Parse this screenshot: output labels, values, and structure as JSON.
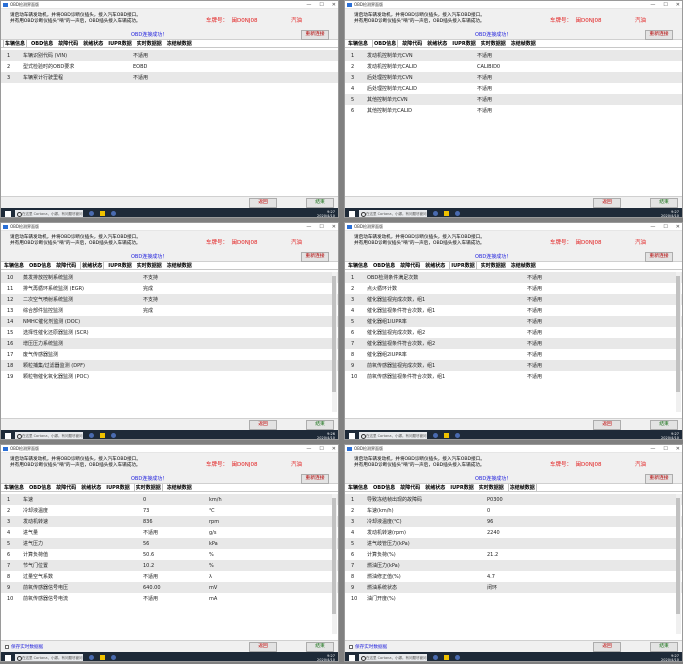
{
  "common": {
    "title": "OBD检测界面版",
    "instruction_line1": "请启动车辆发动机，并将OBD诊断仪插头，接入汽车OBD接口。",
    "instruction_line2": "并有用OBD诊断仪插头\"嘀\"的一声后，OBD插头接入车辆成功。",
    "plate_label": "车牌号：",
    "plate": "闽D0NJ08",
    "fuel": "汽油",
    "connected": "OBD连接成功！",
    "reconnect": "重新连接",
    "back": "返回",
    "end": "结束",
    "save_realtime": "保存实时数据据",
    "search_placeholder": "在这里 Cortana，小娜。有问题尽管问我。",
    "tabs": [
      "车辆信息",
      "OBD信息",
      "故障代码",
      "就绪状态",
      "IUPR数据",
      "实时数据据",
      "冻结帧数据"
    ]
  },
  "panels": [
    {
      "active_tab": 0,
      "clock": [
        "9:27",
        "2020/4/10"
      ],
      "rows": [
        {
          "n": "1",
          "name": "车辆识别代码 (VIN)",
          "value": "不适用",
          "unit": ""
        },
        {
          "n": "2",
          "name": "型式检验时的OBD要求",
          "value": "EOBD",
          "unit": ""
        },
        {
          "n": "3",
          "name": "车辆累计行驶里程",
          "value": "不适用",
          "unit": ""
        }
      ]
    },
    {
      "active_tab": 1,
      "clock": [
        "9:27",
        "2020/4/10"
      ],
      "rows": [
        {
          "n": "1",
          "name": "发动机控制单元CVN",
          "value": "不适用",
          "unit": ""
        },
        {
          "n": "2",
          "name": "发动机控制单元CALID",
          "value": "CALIBID0",
          "unit": ""
        },
        {
          "n": "3",
          "name": "后处理控制单元CVN",
          "value": "不适用",
          "unit": ""
        },
        {
          "n": "4",
          "name": "后处理控制单元CALID",
          "value": "不适用",
          "unit": ""
        },
        {
          "n": "5",
          "name": "其他控制单元CVN",
          "value": "不适用",
          "unit": ""
        },
        {
          "n": "6",
          "name": "其他控制单元CALID",
          "value": "不适用",
          "unit": ""
        }
      ]
    },
    {
      "active_tab": 3,
      "clock": [
        "9:26",
        "2020/4/10"
      ],
      "rows": [
        {
          "n": "10",
          "name": "蒸发排放控制系统监测",
          "value": "不支持",
          "unit": ""
        },
        {
          "n": "11",
          "name": "排气再循环系统监测 (EGR)",
          "value": "完成",
          "unit": ""
        },
        {
          "n": "12",
          "name": "二次空气喷射系统监测",
          "value": "不支持",
          "unit": ""
        },
        {
          "n": "13",
          "name": "综合部件监控监测",
          "value": "完成",
          "unit": ""
        },
        {
          "n": "14",
          "name": "NMHC催化剂监测 (DOC)",
          "value": "",
          "unit": ""
        },
        {
          "n": "15",
          "name": "选择性催化还原器监测 (SCR)",
          "value": "",
          "unit": ""
        },
        {
          "n": "16",
          "name": "增压压力系统监测",
          "value": "",
          "unit": ""
        },
        {
          "n": "17",
          "name": "废气传感器监测",
          "value": "",
          "unit": ""
        },
        {
          "n": "18",
          "name": "颗粒捕集/过滤器监测 (DPF)",
          "value": "",
          "unit": ""
        },
        {
          "n": "19",
          "name": "颗粒物催化氧化器监测 (POC)",
          "value": "",
          "unit": ""
        }
      ]
    },
    {
      "active_tab": 4,
      "clock": [
        "9:27",
        "2020/4/10"
      ],
      "rows": [
        {
          "n": "1",
          "name": "OBD检测条件满足次数",
          "value": "不适用",
          "unit": ""
        },
        {
          "n": "2",
          "name": "点火循环计数",
          "value": "不适用",
          "unit": ""
        },
        {
          "n": "3",
          "name": "催化器监视完成次数，组1",
          "value": "不适用",
          "unit": ""
        },
        {
          "n": "4",
          "name": "催化器监视条件符合次数，组1",
          "value": "不适用",
          "unit": ""
        },
        {
          "n": "5",
          "name": "催化器组1IUPR率",
          "value": "不适用",
          "unit": ""
        },
        {
          "n": "6",
          "name": "催化器监视完成次数，组2",
          "value": "不适用",
          "unit": ""
        },
        {
          "n": "7",
          "name": "催化器监视条件符合次数，组2",
          "value": "不适用",
          "unit": ""
        },
        {
          "n": "8",
          "name": "催化器组2IUPR率",
          "value": "不适用",
          "unit": ""
        },
        {
          "n": "9",
          "name": "前氧传感器监视完成次数，组1",
          "value": "不适用",
          "unit": ""
        },
        {
          "n": "10",
          "name": "前氧传感器监视条件符合次数，组1",
          "value": "不适用",
          "unit": ""
        }
      ]
    },
    {
      "active_tab": 5,
      "clock": [
        "9:27",
        "2020/4/10"
      ],
      "rows": [
        {
          "n": "1",
          "name": "车速",
          "value": "0",
          "unit": "km/h"
        },
        {
          "n": "2",
          "name": "冷却液温度",
          "value": "73",
          "unit": "℃"
        },
        {
          "n": "3",
          "name": "发动机转速",
          "value": "836",
          "unit": "rpm"
        },
        {
          "n": "4",
          "name": "进气量",
          "value": "不适用",
          "unit": "g/s"
        },
        {
          "n": "5",
          "name": "进气压力",
          "value": "56",
          "unit": "kPa"
        },
        {
          "n": "6",
          "name": "计算负荷值",
          "value": "50.6",
          "unit": "%"
        },
        {
          "n": "7",
          "name": "节气门位置",
          "value": "10.2",
          "unit": "%"
        },
        {
          "n": "8",
          "name": "过量空气系数",
          "value": "不适用",
          "unit": "λ"
        },
        {
          "n": "9",
          "name": "前氧传感器信号电压",
          "value": "640.00",
          "unit": "mV"
        },
        {
          "n": "10",
          "name": "前氧传感器信号电流",
          "value": "不适用",
          "unit": "mA"
        }
      ]
    },
    {
      "active_tab": 6,
      "clock": [
        "9:27",
        "2020/4/10"
      ],
      "rows": [
        {
          "n": "1",
          "name": "导致冻结帧出现的故障码",
          "value": "P0300",
          "unit": ""
        },
        {
          "n": "2",
          "name": "车速(km/h)",
          "value": "0",
          "unit": ""
        },
        {
          "n": "3",
          "name": "冷却液温度(℃)",
          "value": "96",
          "unit": ""
        },
        {
          "n": "4",
          "name": "发动机转速(rpm)",
          "value": "2240",
          "unit": ""
        },
        {
          "n": "5",
          "name": "进气歧管压力(kPa)",
          "value": "",
          "unit": ""
        },
        {
          "n": "6",
          "name": "计算负荷(%)",
          "value": "21.2",
          "unit": ""
        },
        {
          "n": "7",
          "name": "燃油压力(kPa)",
          "value": "",
          "unit": ""
        },
        {
          "n": "8",
          "name": "燃油修正值(%)",
          "value": "4.7",
          "unit": ""
        },
        {
          "n": "9",
          "name": "燃油系统状态",
          "value": "闭环",
          "unit": ""
        },
        {
          "n": "10",
          "name": "油门开度(%)",
          "value": "",
          "unit": ""
        }
      ]
    }
  ]
}
